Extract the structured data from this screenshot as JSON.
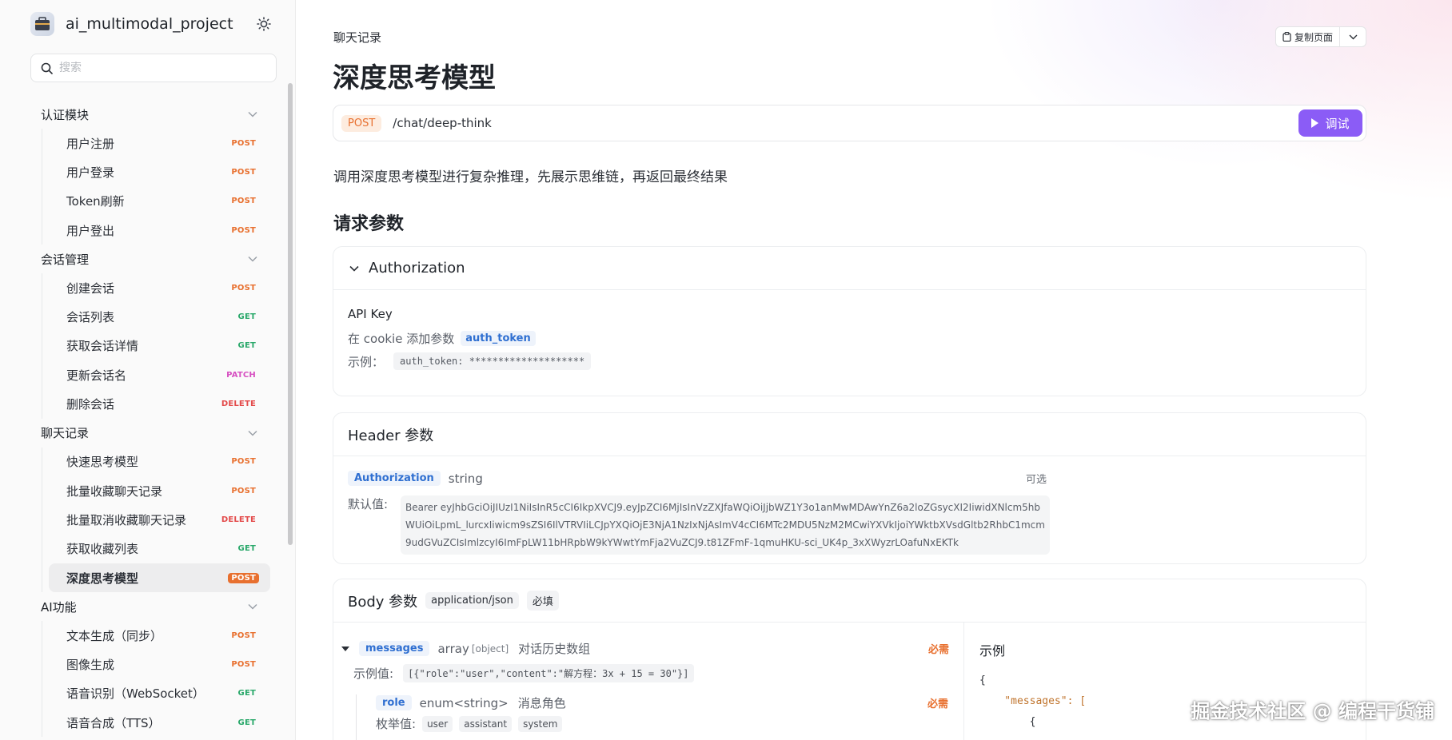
{
  "sidebar": {
    "project_name": "ai_multimodal_project",
    "search_placeholder": "搜索",
    "groups": [
      {
        "label": "认证模块",
        "items": [
          {
            "label": "用户注册",
            "method": "POST"
          },
          {
            "label": "用户登录",
            "method": "POST"
          },
          {
            "label": "Token刷新",
            "method": "POST"
          },
          {
            "label": "用户登出",
            "method": "POST"
          }
        ]
      },
      {
        "label": "会话管理",
        "items": [
          {
            "label": "创建会话",
            "method": "POST"
          },
          {
            "label": "会话列表",
            "method": "GET"
          },
          {
            "label": "获取会话详情",
            "method": "GET"
          },
          {
            "label": "更新会话名",
            "method": "PATCH"
          },
          {
            "label": "删除会话",
            "method": "DELETE"
          }
        ]
      },
      {
        "label": "聊天记录",
        "items": [
          {
            "label": "快速思考模型",
            "method": "POST"
          },
          {
            "label": "批量收藏聊天记录",
            "method": "POST"
          },
          {
            "label": "批量取消收藏聊天记录",
            "method": "DELETE"
          },
          {
            "label": "获取收藏列表",
            "method": "GET"
          },
          {
            "label": "深度思考模型",
            "method": "POST",
            "active": true
          }
        ]
      },
      {
        "label": "AI功能",
        "items": [
          {
            "label": "文本生成（同步）",
            "method": "POST"
          },
          {
            "label": "图像生成",
            "method": "POST"
          },
          {
            "label": "语音识别（WebSocket）",
            "method": "GET"
          },
          {
            "label": "语音合成（TTS）",
            "method": "GET"
          }
        ]
      }
    ]
  },
  "main": {
    "breadcrumb": "聊天记录",
    "title": "深度思考模型",
    "copy_label": "复制页面",
    "endpoint": {
      "method": "POST",
      "path": "/chat/deep-think",
      "run_label": "调试"
    },
    "description": "调用深度思考模型进行复杂推理，先展示思维链，再返回最终结果",
    "request_params_title": "请求参数",
    "auth": {
      "title": "Authorization",
      "api_key": "API Key",
      "cookie_text": "在 cookie 添加参数",
      "cookie_param": "auth_token",
      "example_label": "示例：",
      "example_value": "auth_token: ********************"
    },
    "header": {
      "title": "Header 参数",
      "param_name": "Authorization",
      "param_type": "string",
      "optional": "可选",
      "default_label": "默认值:",
      "default_value": "Bearer eyJhbGciOiJIUzI1NiIsInR5cCI6IkpXVCJ9.eyJpZCI6MjIsInVzZXJfaWQiOiJjbWZ1Y3o1anMwMDAwYnZ6a2loZGsycXI2IiwidXNlcm5hbWUiOiLpmL_lurcxIiwicm9sZSI6IlVTRVIiLCJpYXQiOjE3NjA1NzIxNjAsImV4cCI6MTc2MDU5NzM2MCwiYXVkIjoiYWktbXVsdGltb2RhbC1mcm9udGVuZCIsImlzcyI6ImFpLW11bHRpbW9kYWwtYmFja2VuZCJ9.t81ZFmF-1qmuHKU-sci_UK4p_3xXWyzrLOafuNxEKTk"
    },
    "body": {
      "title": "Body 参数",
      "content_type": "application/json",
      "required_chip": "必填",
      "messages": {
        "name": "messages",
        "type": "array",
        "subtype": "[object]",
        "desc": "对话历史数组",
        "required": "必需",
        "example_label": "示例值:",
        "example_value": "[{\"role\":\"user\",\"content\":\"解方程：3x + 15 = 30\"}]"
      },
      "role": {
        "name": "role",
        "type": "enum<string>",
        "desc": "消息角色",
        "required": "必需",
        "enum_label": "枚举值:",
        "enum_values": [
          "user",
          "assistant",
          "system"
        ]
      },
      "example_title": "示例",
      "code_lines": [
        "{",
        "    \"messages\": [",
        "        {"
      ]
    }
  },
  "watermark": "掘金技术社区 @ 编程干货铺"
}
